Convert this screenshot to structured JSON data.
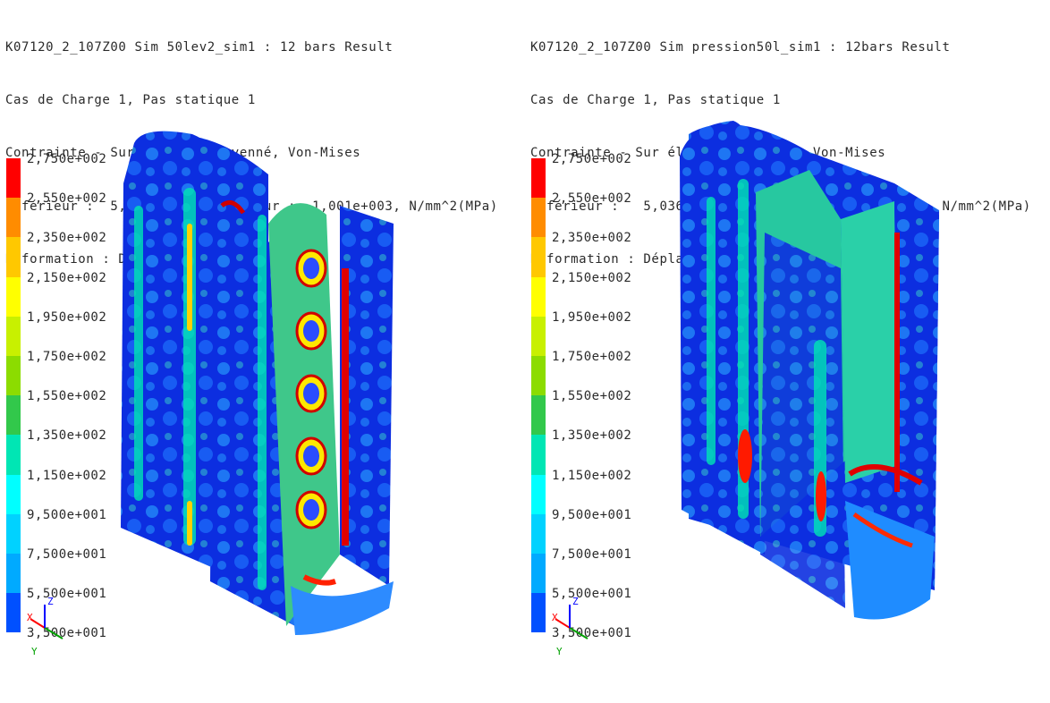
{
  "left_panel": {
    "lines": [
      "K07120_2_107Z00 Sim 50lev2_sim1 : 12 bars Result",
      "Cas de Charge 1, Pas statique 1",
      "Contrainte - Sur élément, Moyenné, Von-Mises",
      "Inférieur :  5,389e-002, Supérieur :  1,001e+003, N/mm^2(MPa)",
      "Déformation : Déplacement - Nodal"
    ]
  },
  "right_panel": {
    "lines": [
      "K07120_2_107Z00 Sim pression50l_sim1 : 12bars Result",
      "Cas de Charge 1, Pas statique 1",
      "Contrainte - Sur élément, Moyenné, Von-Mises",
      "Inférieur :   5,036e-001, Supérieur :  2,713e+003, N/mm^2(MPa)",
      "Déformation : Déplacement - Nodal"
    ]
  },
  "legend": {
    "ticks": [
      "2,750e+002",
      "2,550e+002",
      "2,350e+002",
      "2,150e+002",
      "1,950e+002",
      "1,750e+002",
      "1,550e+002",
      "1,350e+002",
      "1,150e+002",
      "9,500e+001",
      "7,500e+001",
      "5,500e+001",
      "3,500e+001"
    ],
    "colors": [
      "#ff0000",
      "#ff8c00",
      "#ffc800",
      "#ffff00",
      "#c8f000",
      "#8cdc00",
      "#32c84b",
      "#00e6b4",
      "#00ffff",
      "#00d2ff",
      "#00aaff",
      "#0050ff",
      "#0000c8"
    ]
  },
  "triad": {
    "x": "X",
    "y": "Y",
    "z": "Z"
  }
}
